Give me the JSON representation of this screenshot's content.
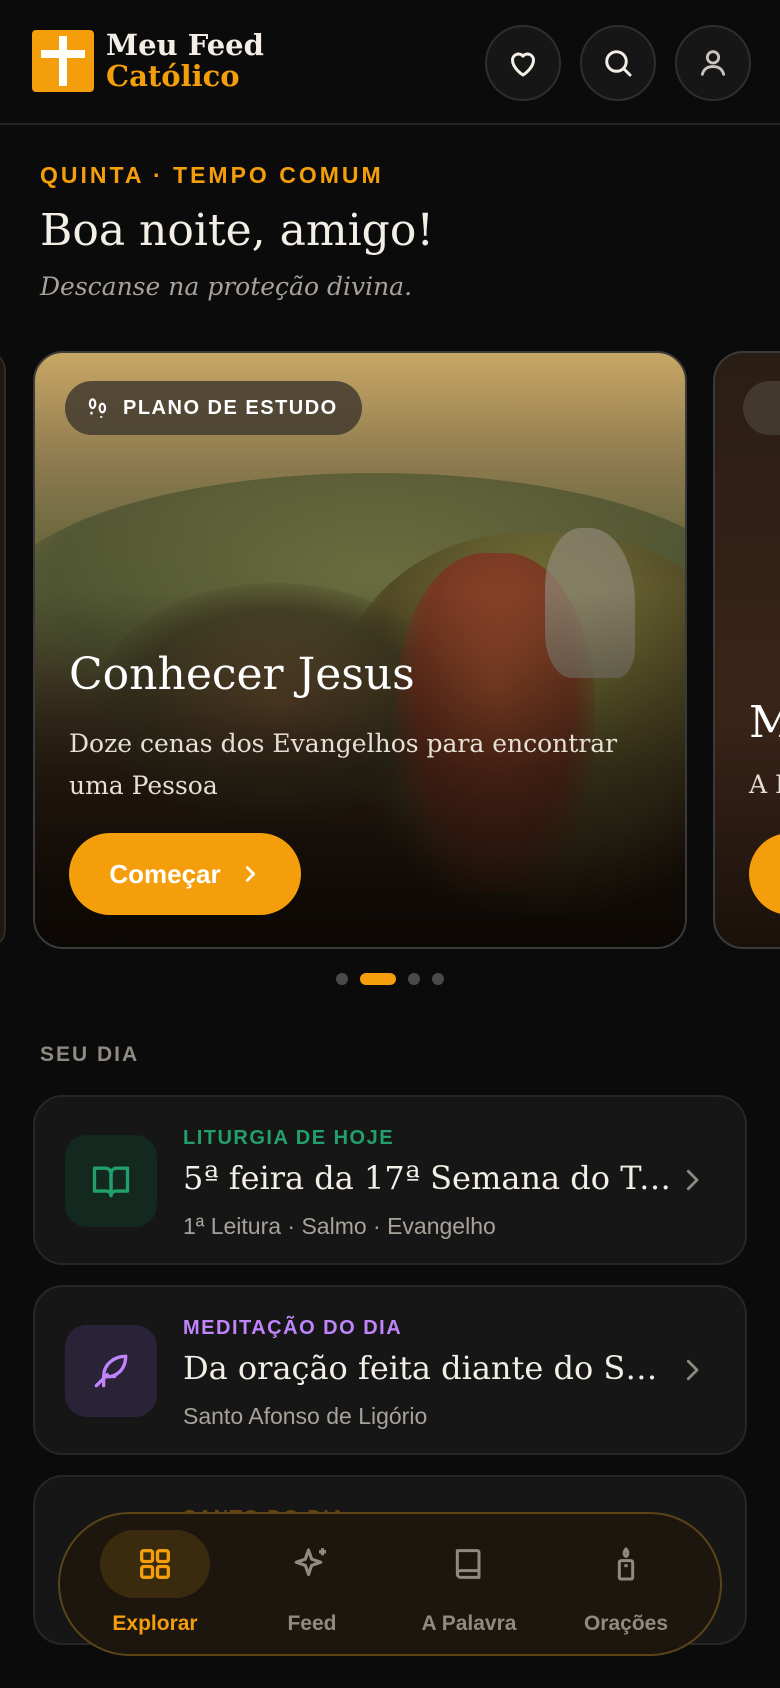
{
  "header": {
    "brand_line1": "Meu Feed",
    "brand_line2": "Católico",
    "icons": [
      "heart-icon",
      "search-icon",
      "user-icon"
    ]
  },
  "greeting": {
    "season": "QUINTA · TEMPO COMUM",
    "title": "Boa noite, amigo!",
    "subtitle": "Descanse na proteção divina."
  },
  "carousel": {
    "active_index": 1,
    "dot_count": 4,
    "card": {
      "badge": "PLANO DE ESTUDO",
      "title": "Conhecer Jesus",
      "description": "Doze cenas dos Evangelhos para encontrar uma Pessoa",
      "cta": "Começar"
    },
    "next_card": {
      "title_partial": "M",
      "desc_partial": "A I"
    }
  },
  "your_day": {
    "label": "SEU DIA",
    "items": [
      {
        "kicker": "LITURGIA DE HOJE",
        "title": "5ª feira da 17ª Semana do Te...",
        "subtitle": "1ª Leitura · Salmo · Evangelho",
        "icon": "book-open-icon",
        "accent": "#22a06b"
      },
      {
        "kicker": "MEDITAÇÃO DO DIA",
        "title": "Da oração feita diante do San...",
        "subtitle": "Santo Afonso de Ligório",
        "icon": "feather-icon",
        "accent": "#c084fc"
      },
      {
        "kicker": "SANTO DO DIA",
        "accent": "#f59e0b"
      }
    ]
  },
  "nav": {
    "items": [
      {
        "label": "Explorar",
        "icon": "grid-icon",
        "active": true
      },
      {
        "label": "Feed",
        "icon": "sparkles-icon",
        "active": false
      },
      {
        "label": "A Palavra",
        "icon": "bible-icon",
        "active": false
      },
      {
        "label": "Orações",
        "icon": "candle-icon",
        "active": false
      }
    ]
  },
  "colors": {
    "accent": "#f59e0b",
    "background": "#0b0b0b"
  }
}
